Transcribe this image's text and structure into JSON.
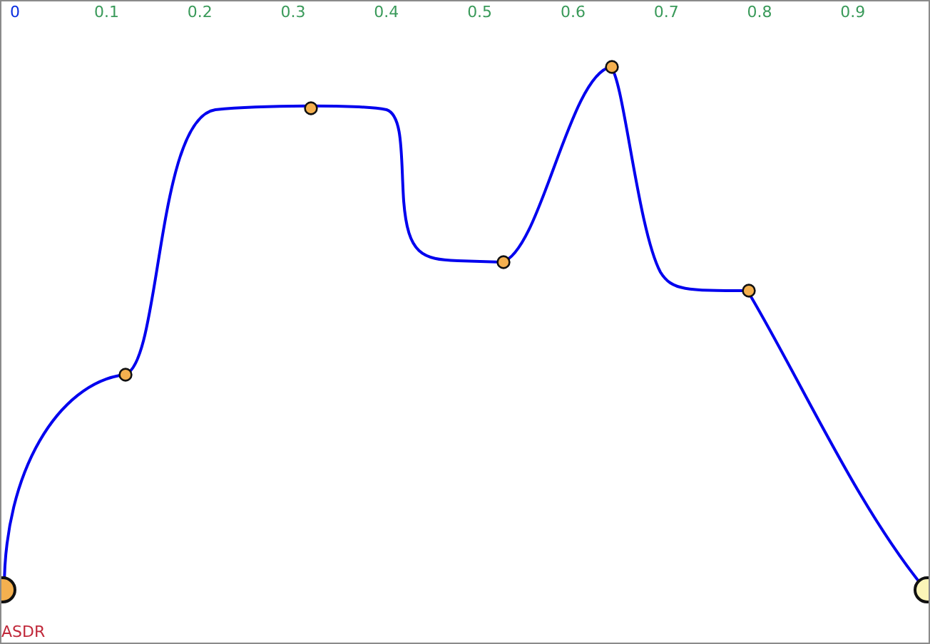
{
  "axis": {
    "ticks": [
      {
        "label": "0",
        "selected": true
      },
      {
        "label": "0.1",
        "selected": false
      },
      {
        "label": "0.2",
        "selected": false
      },
      {
        "label": "0.3",
        "selected": false
      },
      {
        "label": "0.4",
        "selected": false
      },
      {
        "label": "0.5",
        "selected": false
      },
      {
        "label": "0.6",
        "selected": false
      },
      {
        "label": "0.7",
        "selected": false
      },
      {
        "label": "0.8",
        "selected": false
      },
      {
        "label": "0.9",
        "selected": false
      }
    ]
  },
  "envelope": {
    "label": "ASDR"
  }
}
